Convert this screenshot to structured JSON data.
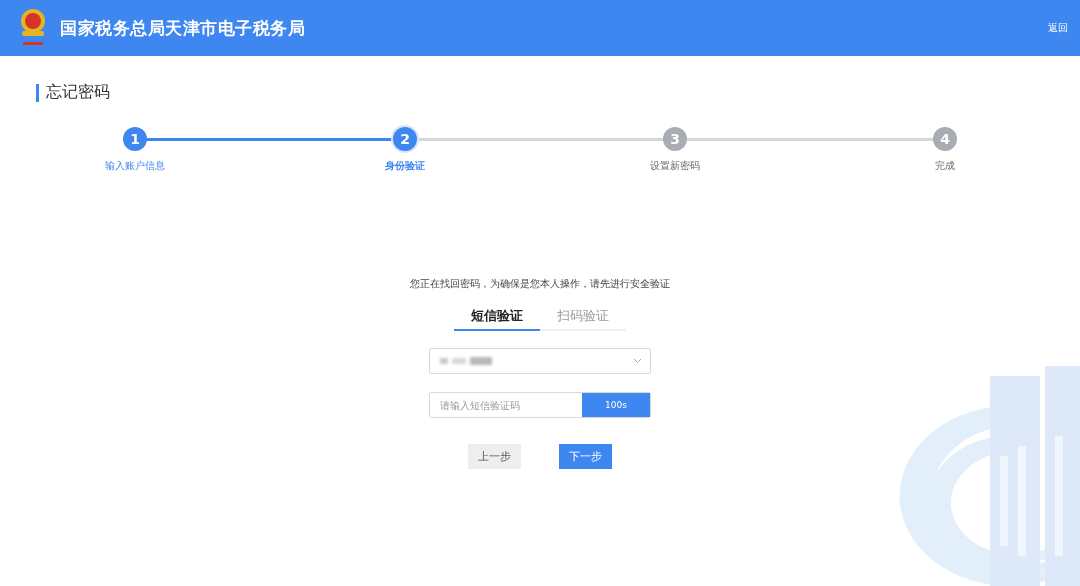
{
  "header": {
    "title": "国家税务总局天津市电子税务局",
    "back_link": "返回"
  },
  "page_title": "忘记密码",
  "steps": [
    {
      "number": "1",
      "label": "输入账户信息",
      "completed": true,
      "selected": false
    },
    {
      "number": "2",
      "label": "身份验证",
      "completed": false,
      "selected": true
    },
    {
      "number": "3",
      "label": "设置新密码",
      "completed": false,
      "selected": false
    },
    {
      "number": "4",
      "label": "完成",
      "completed": false,
      "selected": false
    }
  ],
  "prompt": "您正在找回密码，为确保是您本人操作，请先进行安全验证",
  "tabs": [
    {
      "label": "短信验证",
      "selected": true
    },
    {
      "label": "扫码验证",
      "selected": false
    }
  ],
  "phone_select": {
    "redacted": true
  },
  "code_field": {
    "placeholder": "请输入短信验证码",
    "countdown": "100s"
  },
  "buttons": [
    {
      "label": "上一步",
      "kind": "secondary"
    },
    {
      "label": "下一步",
      "kind": "primary"
    }
  ]
}
